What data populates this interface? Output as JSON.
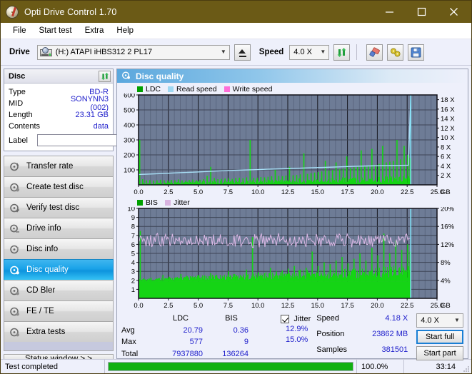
{
  "window": {
    "title": "Opti Drive Control 1.70",
    "icon": "disc-pen-icon",
    "minimize": "minimize-icon",
    "maximize": "maximize-icon",
    "close": "close-icon"
  },
  "menu": {
    "items": [
      {
        "label": "File"
      },
      {
        "label": "Start test"
      },
      {
        "label": "Extra"
      },
      {
        "label": "Help"
      }
    ]
  },
  "toolbar": {
    "drive_label": "Drive",
    "drive_value": "(H:)  ATAPI iHBS312  2 PL17",
    "eject_icon": "eject-icon",
    "speed_label": "Speed",
    "speed_value": "4.0 X",
    "refresh_icon": "refresh-icon",
    "eraser_icon": "eraser-icon",
    "tools_icon": "disc-tools-icon",
    "save_icon": "save-icon"
  },
  "disc_panel": {
    "header": "Disc",
    "refresh_icon": "refresh-icon",
    "rows": [
      {
        "key": "Type",
        "value": "BD-R"
      },
      {
        "key": "MID",
        "value": "SONYNN3 (002)"
      },
      {
        "key": "Length",
        "value": "23.31 GB"
      },
      {
        "key": "Contents",
        "value": "data"
      }
    ],
    "label_key": "Label",
    "label_value": "",
    "label_button_icon": "cd-icon"
  },
  "sidebar": {
    "items": [
      {
        "label": "Transfer rate",
        "icon": "disc-transfer-icon",
        "active": false
      },
      {
        "label": "Create test disc",
        "icon": "disc-create-icon",
        "active": false
      },
      {
        "label": "Verify test disc",
        "icon": "disc-verify-icon",
        "active": false
      },
      {
        "label": "Drive info",
        "icon": "disc-drive-icon",
        "active": false
      },
      {
        "label": "Disc info",
        "icon": "disc-info-icon",
        "active": false
      },
      {
        "label": "Disc quality",
        "icon": "disc-quality-icon",
        "active": true
      },
      {
        "label": "CD Bler",
        "icon": "disc-bler-icon",
        "active": false
      },
      {
        "label": "FE / TE",
        "icon": "disc-fete-icon",
        "active": false
      },
      {
        "label": "Extra tests",
        "icon": "disc-extra-icon",
        "active": false
      }
    ],
    "status_window_button": "Status window > >"
  },
  "content": {
    "header": "Disc quality",
    "header_icon": "disc-quality-icon"
  },
  "chart_data": [
    {
      "id": "ldc-chart",
      "type": "line",
      "title": "LDC / Read speed",
      "legend": [
        {
          "label": "LDC",
          "color": "#00a000"
        },
        {
          "label": "Read speed",
          "color": "#9fd8f2"
        },
        {
          "label": "Write speed",
          "color": "#ff6fd8"
        }
      ],
      "legend_position": "top-left",
      "grid": true,
      "xlabel": "GB",
      "x_ticks": [
        "0.0",
        "2.5",
        "5.0",
        "7.5",
        "10.0",
        "12.5",
        "15.0",
        "17.5",
        "20.0",
        "22.5",
        "25.0"
      ],
      "xlim": [
        0.0,
        25.0
      ],
      "ylabel_left": "LDC",
      "y_ticks_left": [
        "100",
        "200",
        "300",
        "400",
        "500",
        "600"
      ],
      "ylim_left": [
        0,
        600
      ],
      "ylabel_right": "Speed",
      "y_ticks_right": [
        "2 X",
        "4 X",
        "6 X",
        "8 X",
        "10 X",
        "12 X",
        "14 X",
        "16 X",
        "18 X"
      ],
      "ylim_right": [
        0,
        19
      ],
      "plot_bg": "#6e7c96",
      "data_end_marker_gb": 22.8,
      "series": [
        {
          "name": "LDC",
          "kind": "bars",
          "x": [
            0.05,
            0.3,
            0.6,
            0.9,
            1.2,
            1.5,
            1.8,
            2.1,
            2.4,
            2.7,
            3.0,
            3.3,
            3.6,
            3.9,
            4.2,
            4.5,
            4.8,
            5.1,
            5.4,
            5.7,
            6.0,
            6.3,
            6.6,
            6.9,
            7.2,
            7.5,
            7.8,
            8.1,
            8.4,
            8.7,
            9.0,
            9.3,
            9.6,
            9.9,
            10.2,
            10.5,
            10.8,
            11.1,
            11.4,
            11.7,
            12.0,
            12.3,
            12.6,
            12.9,
            13.2,
            13.5,
            13.8,
            14.1,
            14.4,
            14.7,
            15.0,
            15.3,
            15.6,
            15.9,
            16.2,
            16.5,
            16.8,
            17.1,
            17.4,
            17.7,
            18.0,
            18.3,
            18.6,
            18.9,
            19.2,
            19.5,
            19.8,
            20.1,
            20.4,
            20.7,
            21.0,
            21.3,
            21.6,
            21.9,
            22.2,
            22.5,
            22.7
          ],
          "values": [
            300,
            38,
            30,
            32,
            28,
            30,
            34,
            30,
            28,
            33,
            30,
            36,
            30,
            28,
            32,
            35,
            30,
            34,
            38,
            60,
            120,
            45,
            38,
            40,
            42,
            44,
            40,
            46,
            48,
            44,
            50,
            300,
            46,
            48,
            52,
            50,
            54,
            58,
            100,
            60,
            58,
            62,
            120,
            64,
            66,
            70,
            210,
            74,
            78,
            82,
            86,
            90,
            160,
            96,
            100,
            150,
            104,
            108,
            190,
            112,
            118,
            120,
            230,
            126,
            130,
            240,
            134,
            140,
            260,
            150,
            155,
            160,
            300,
            170,
            260,
            200,
            180
          ]
        },
        {
          "name": "Read speed",
          "kind": "line",
          "x": [
            0.0,
            1.2,
            2.4,
            3.6,
            4.8,
            6.0,
            7.2,
            8.4,
            9.6,
            10.8,
            12.0,
            13.2,
            14.4,
            15.6,
            16.8,
            18.0,
            19.2,
            20.4,
            21.6,
            22.6,
            22.8
          ],
          "values": [
            2.2,
            2.3,
            2.45,
            2.6,
            2.7,
            2.85,
            3.0,
            3.1,
            3.2,
            3.3,
            3.4,
            3.5,
            3.6,
            3.7,
            3.8,
            3.9,
            4.0,
            4.05,
            4.1,
            4.15,
            18.5
          ]
        }
      ]
    },
    {
      "id": "bis-chart",
      "type": "line",
      "title": "BIS / Jitter",
      "legend": [
        {
          "label": "BIS",
          "color": "#00a000"
        },
        {
          "label": "Jitter",
          "color": "#d9b3e0"
        }
      ],
      "legend_position": "top-left",
      "grid": true,
      "xlabel": "GB",
      "x_ticks": [
        "0.0",
        "2.5",
        "5.0",
        "7.5",
        "10.0",
        "12.5",
        "15.0",
        "17.5",
        "20.0",
        "22.5",
        "25.0"
      ],
      "xlim": [
        0.0,
        25.0
      ],
      "ylabel_left": "BIS",
      "y_ticks_left": [
        "1",
        "2",
        "3",
        "4",
        "5",
        "6",
        "7",
        "8",
        "9",
        "10"
      ],
      "ylim_left": [
        0,
        10
      ],
      "ylabel_right": "Jitter",
      "y_ticks_right": [
        "4%",
        "8%",
        "12%",
        "16%",
        "20%"
      ],
      "ylim_right": [
        0,
        20
      ],
      "plot_bg": "#6e7c96",
      "data_end_marker_gb": 22.8,
      "series": [
        {
          "name": "BIS",
          "kind": "bars",
          "baseline": 1.9,
          "x": [
            0.1,
            0.5,
            1.0,
            1.5,
            2.0,
            2.5,
            3.0,
            3.5,
            4.0,
            4.5,
            5.0,
            5.5,
            6.0,
            6.5,
            7.0,
            7.5,
            8.0,
            8.5,
            9.0,
            9.5,
            10.0,
            10.5,
            11.0,
            11.5,
            12.0,
            12.5,
            13.0,
            13.5,
            14.0,
            14.5,
            15.0,
            15.5,
            16.0,
            16.5,
            17.0,
            17.5,
            18.0,
            18.5,
            19.0,
            19.5,
            20.0,
            20.5,
            21.0,
            21.5,
            22.0,
            22.5,
            22.7
          ],
          "values": [
            7.5,
            2.1,
            2.3,
            2.2,
            2.6,
            2.4,
            2.3,
            2.7,
            2.5,
            2.4,
            2.6,
            2.5,
            2.8,
            2.6,
            2.5,
            3.0,
            2.7,
            2.6,
            3.2,
            6.8,
            2.9,
            2.8,
            3.4,
            3.0,
            3.1,
            3.3,
            3.6,
            3.2,
            3.4,
            5.2,
            3.6,
            4.0,
            3.8,
            4.2,
            4.6,
            3.9,
            4.4,
            5.0,
            4.2,
            5.6,
            4.8,
            7.2,
            5.0,
            6.4,
            5.4,
            6.0,
            5.2
          ]
        },
        {
          "name": "Jitter",
          "kind": "line",
          "values_pct_avg": 12.9,
          "values_pct_max": 15.0
        }
      ]
    }
  ],
  "stats": {
    "columns": [
      "LDC",
      "BIS"
    ],
    "rows": [
      {
        "label": "Avg",
        "ldc": "20.79",
        "bis": "0.36",
        "jitter": "12.9%"
      },
      {
        "label": "Max",
        "ldc": "577",
        "bis": "9",
        "jitter": "15.0%"
      },
      {
        "label": "Total",
        "ldc": "7937880",
        "bis": "136264",
        "jitter": ""
      }
    ],
    "jitter_label": "Jitter",
    "jitter_checked": true,
    "speed_label": "Speed",
    "speed_value": "4.18 X",
    "position_label": "Position",
    "position_value": "23862 MB",
    "samples_label": "Samples",
    "samples_value": "381501",
    "speed_select": "4.0 X",
    "start_full_button": "Start full",
    "start_part_button": "Start part"
  },
  "statusbar": {
    "message": "Test completed",
    "progress_percent": 100.0,
    "progress_text": "100.0%",
    "elapsed": "33:14"
  },
  "colors": {
    "title_bg": "#6b5a16",
    "accent": "#1aa3e8",
    "value_text": "#2222cc",
    "plot_bg": "#6e7c96",
    "ldc_green": "#00cc00",
    "read_speed": "#9fd8f2",
    "write_speed": "#ff6fd8",
    "jitter_pink": "#d9b3e0",
    "progress_green": "#11b011"
  }
}
